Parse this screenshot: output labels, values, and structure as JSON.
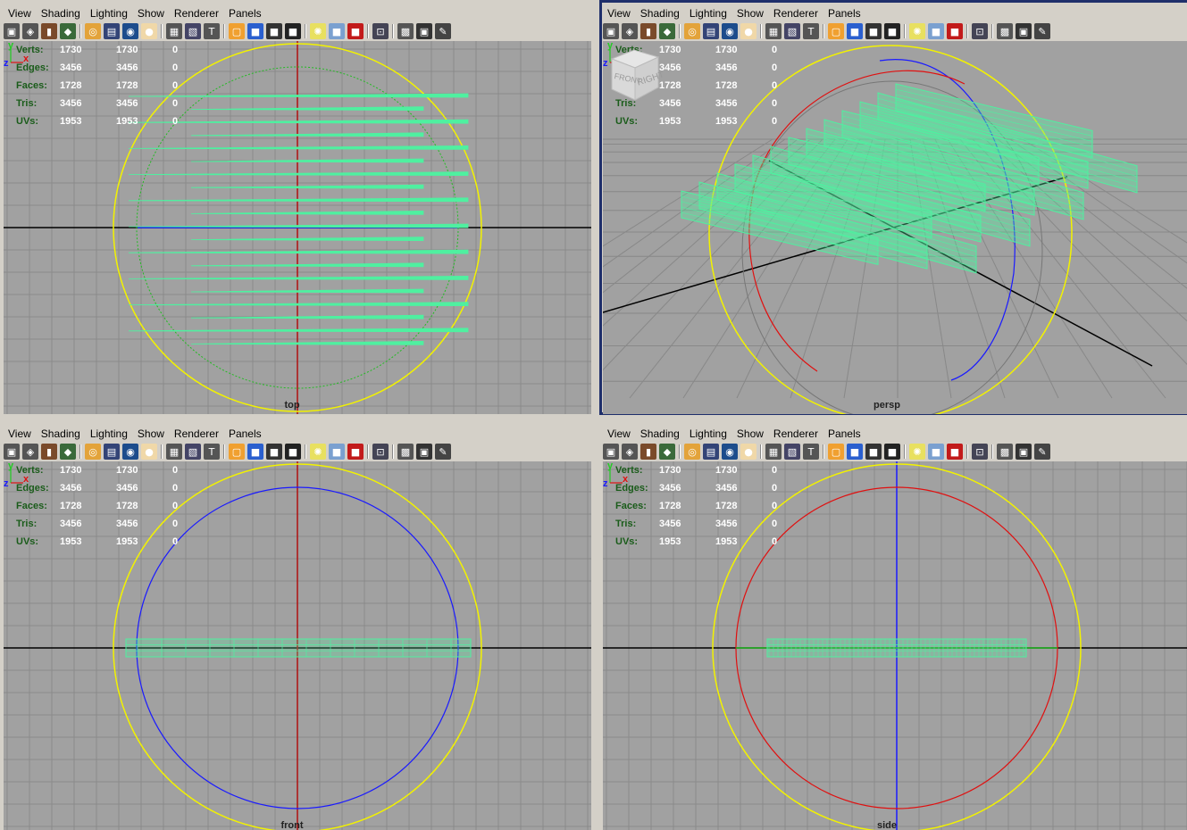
{
  "menu": [
    "View",
    "Shading",
    "Lighting",
    "Show",
    "Renderer",
    "Panels"
  ],
  "hud": {
    "rows": [
      {
        "label": "Verts:",
        "v1": "1730",
        "v2": "1730",
        "v3": "0"
      },
      {
        "label": "Edges:",
        "v1": "3456",
        "v2": "3456",
        "v3": "0"
      },
      {
        "label": "Faces:",
        "v1": "1728",
        "v2": "1728",
        "v3": "0"
      },
      {
        "label": "Tris:",
        "v1": "3456",
        "v2": "3456",
        "v3": "0"
      },
      {
        "label": "UVs:",
        "v1": "1953",
        "v2": "1953",
        "v3": "0"
      }
    ]
  },
  "panels": {
    "top": {
      "camera": "top"
    },
    "persp": {
      "camera": "persp",
      "cube_front": "FRONT",
      "cube_right": "RIGHT"
    },
    "front": {
      "camera": "front"
    },
    "side": {
      "camera": "side"
    }
  },
  "axes_letters": {
    "x": "x",
    "y": "y",
    "z": "z"
  },
  "colors": {
    "viewport_bg": "#a1a1a1",
    "grid": "#8a8a8a",
    "mesh": "#4ff0a0",
    "ring": "#f2f200",
    "active_border": "#1f2f6b"
  }
}
